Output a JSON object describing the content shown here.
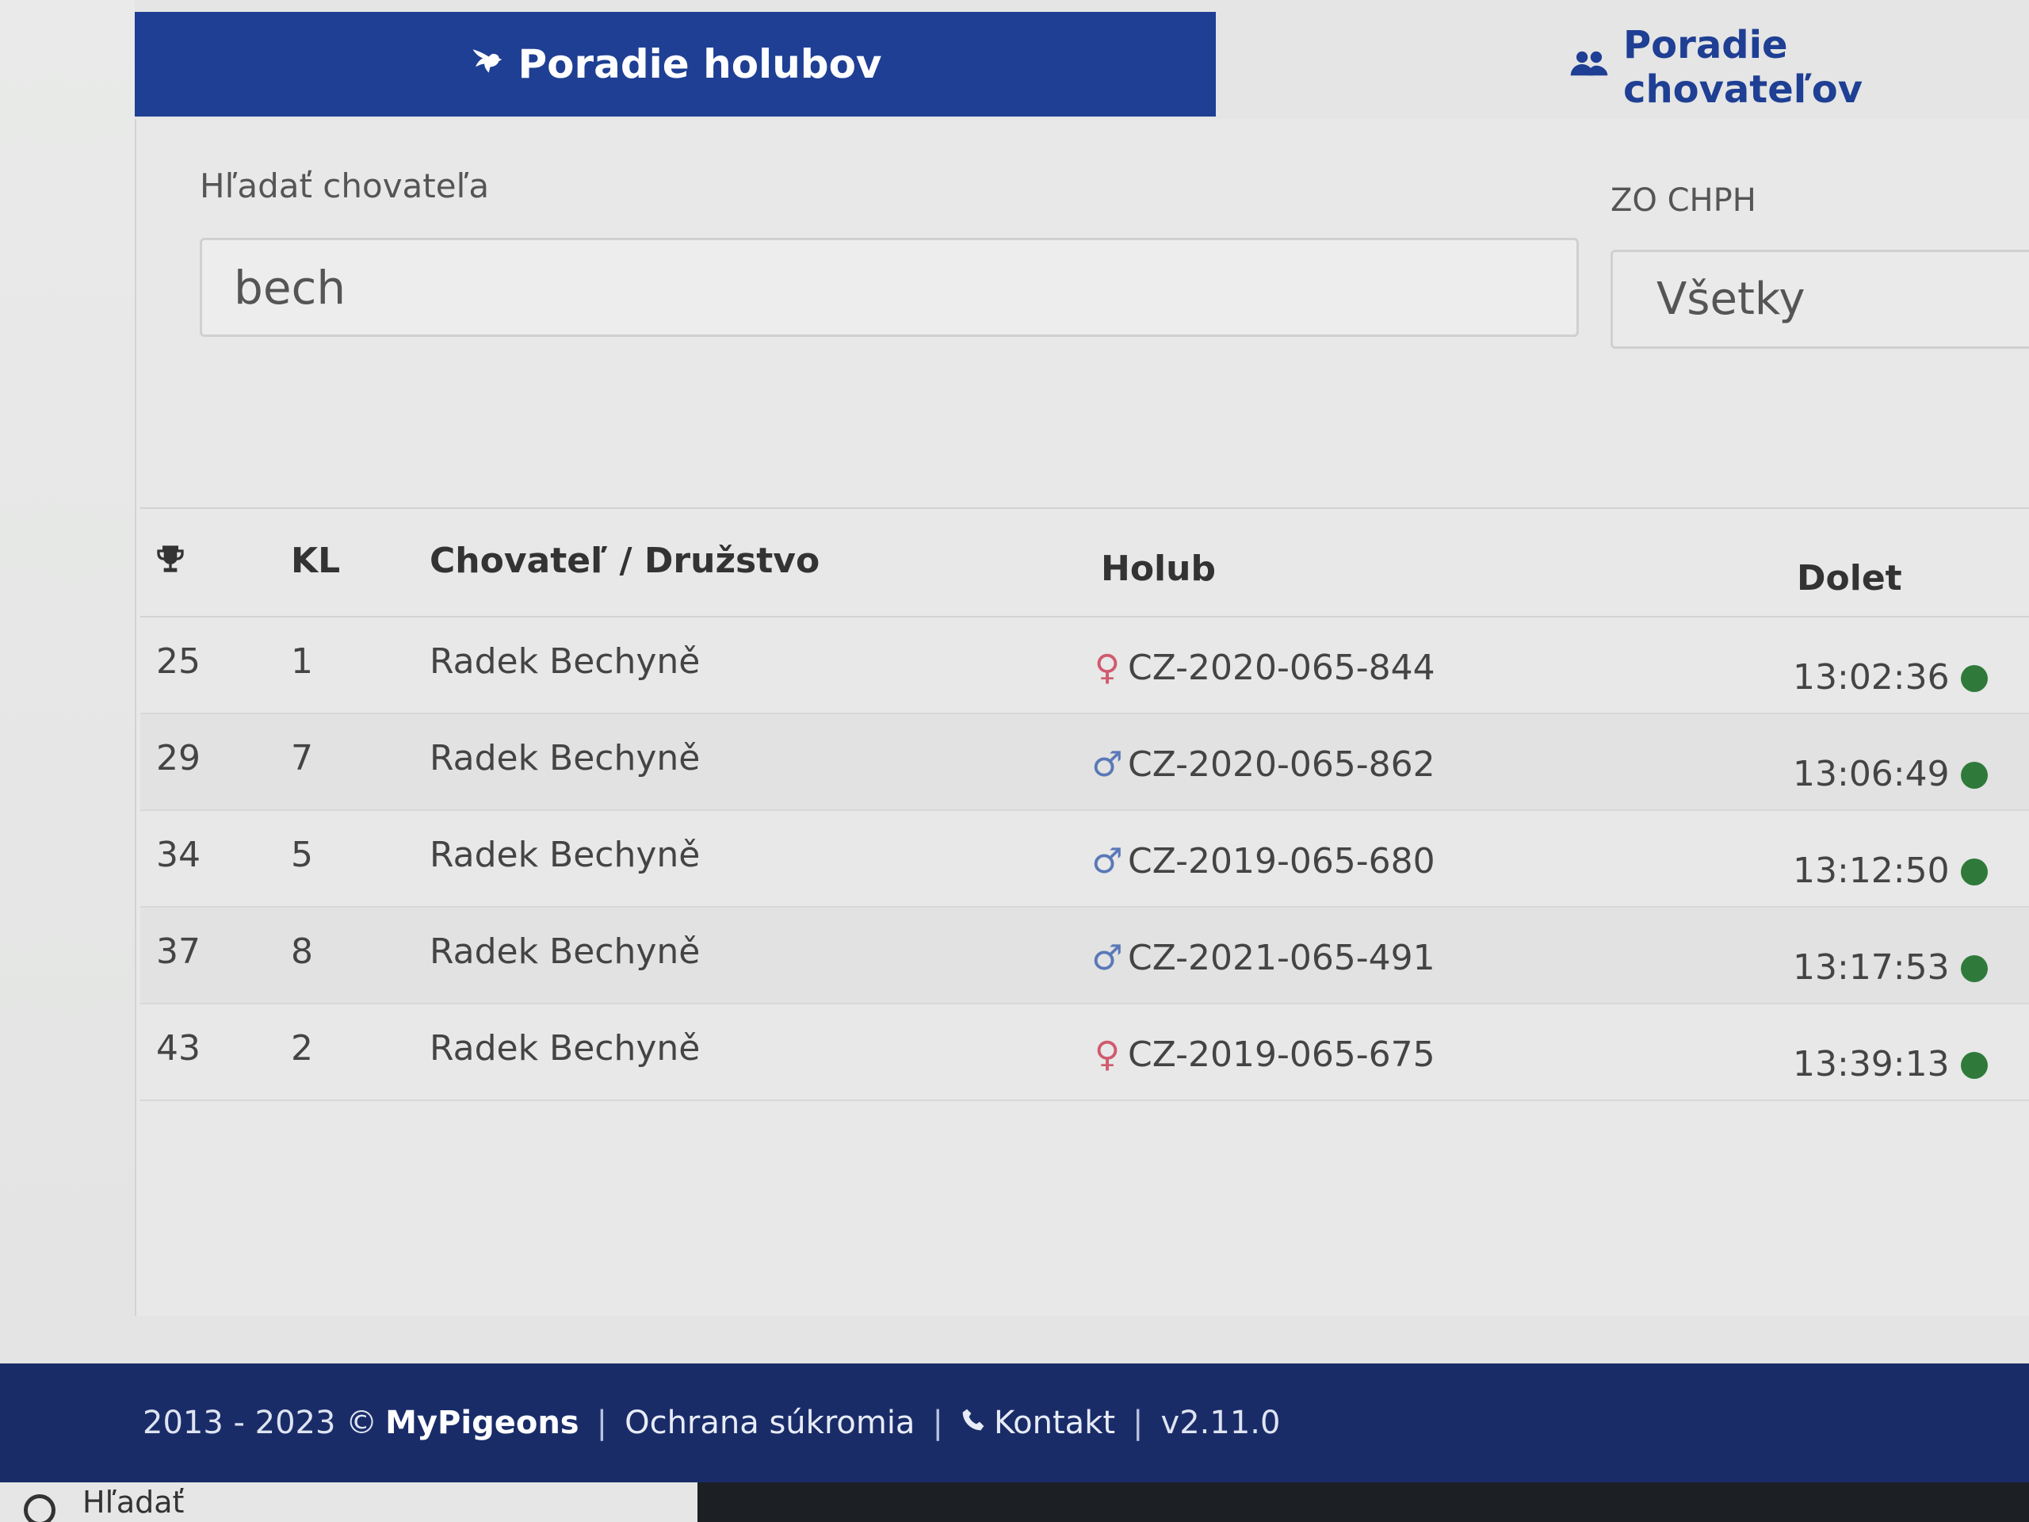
{
  "tabs": {
    "active": {
      "label": "Poradie holubov",
      "icon": "dove-icon"
    },
    "inactive": {
      "label": "Poradie chovateľov",
      "icon": "users-icon"
    }
  },
  "filters": {
    "search_label": "Hľadať chovateľa",
    "search_value": "bech",
    "org_label": "ZO CHPH",
    "org_value": "Všetky"
  },
  "table": {
    "headers": {
      "rank_icon": "trophy-icon",
      "kl": "KL",
      "breeder": "Chovateľ / Družstvo",
      "pigeon": "Holub",
      "arrival": "Dolet"
    },
    "rows": [
      {
        "rank": "25",
        "kl": "1",
        "breeder": "Radek Bechyně",
        "sex": "female",
        "sex_symbol": "♀",
        "pigeon": "CZ-2020-065-844",
        "arrival": "13:02:36"
      },
      {
        "rank": "29",
        "kl": "7",
        "breeder": "Radek Bechyně",
        "sex": "male",
        "sex_symbol": "♂",
        "pigeon": "CZ-2020-065-862",
        "arrival": "13:06:49"
      },
      {
        "rank": "34",
        "kl": "5",
        "breeder": "Radek Bechyně",
        "sex": "male",
        "sex_symbol": "♂",
        "pigeon": "CZ-2019-065-680",
        "arrival": "13:12:50"
      },
      {
        "rank": "37",
        "kl": "8",
        "breeder": "Radek Bechyně",
        "sex": "male",
        "sex_symbol": "♂",
        "pigeon": "CZ-2021-065-491",
        "arrival": "13:17:53"
      },
      {
        "rank": "43",
        "kl": "2",
        "breeder": "Radek Bechyně",
        "sex": "female",
        "sex_symbol": "♀",
        "pigeon": "CZ-2019-065-675",
        "arrival": "13:39:13"
      }
    ]
  },
  "footer": {
    "copyright": "2013 - 2023 ©",
    "brand": "MyPigeons",
    "privacy": "Ochrana súkromia",
    "contact": "Kontakt",
    "version": "v2.11.0"
  },
  "taskbar": {
    "search_text": "Hľadať"
  },
  "colors": {
    "brand_blue": "#1f3f94",
    "footer_blue": "#1a2c68",
    "status_green": "#2f7a3a",
    "female": "#d05a6e",
    "male": "#5a78b8"
  }
}
